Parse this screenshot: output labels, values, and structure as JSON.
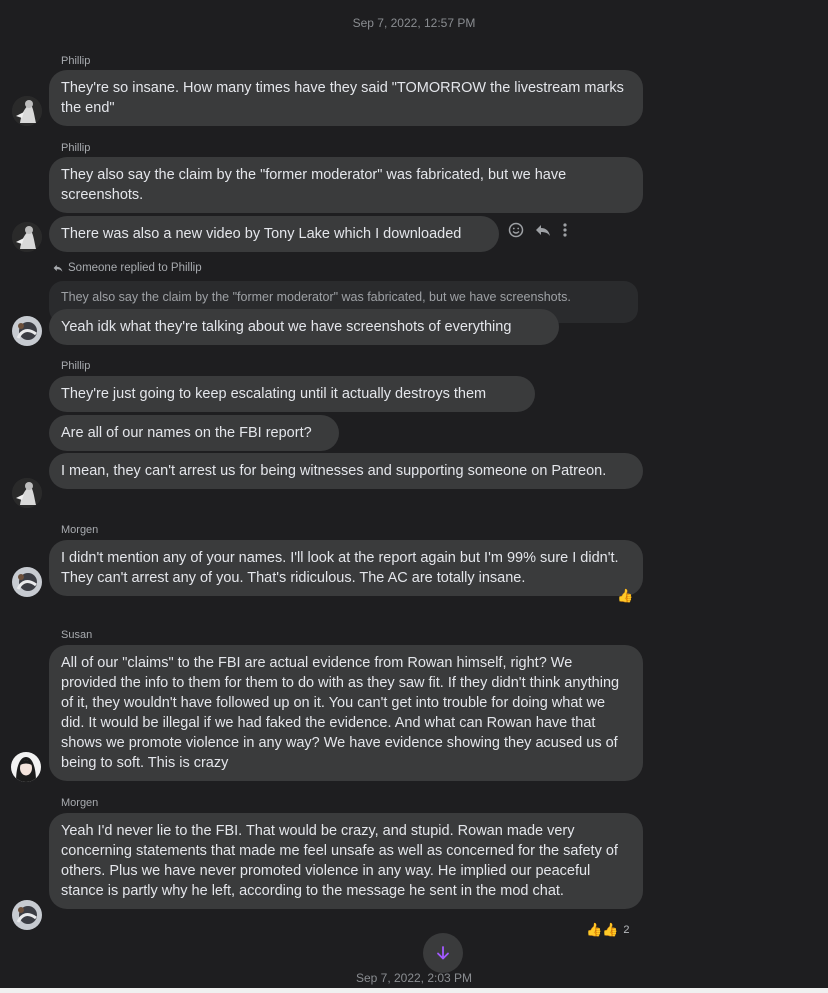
{
  "timestamps": {
    "top": "Sep 7, 2022, 12:57 PM",
    "bottom": "Sep 7, 2022, 2:03 PM"
  },
  "messages": [
    {
      "sender": "Phillip",
      "text": "They're so insane. How many times have they said \"TOMORROW the livestream marks the end\""
    },
    {
      "sender": "Phillip",
      "text1": "They also say the claim by the \"former moderator\" was fabricated, but we have screenshots.",
      "text2": "There was also a new video by Tony Lake which I downloaded"
    },
    {
      "reply_label": "Someone replied to Phillip",
      "quote": "They also say the claim by the \"former moderator\" was fabricated, but we have screenshots.",
      "text": "Yeah idk what they're talking about we have screenshots of everything"
    },
    {
      "sender": "Phillip",
      "text1": "They're just going to keep escalating until it actually destroys them",
      "text2": "Are all of our names on the FBI report?",
      "text3": "I mean, they can't arrest us for being witnesses and supporting someone on Patreon."
    },
    {
      "sender": "Morgen",
      "text": "I didn't mention any of your names. I'll look at the report again but I'm 99% sure I didn't. They can't arrest any of you. That's ridiculous. The AC are totally insane.",
      "reaction": "👍"
    },
    {
      "sender": "Susan",
      "text": "All of our \"claims\" to the FBI are actual evidence from Rowan himself, right? We provided the info to them for them to do with as they saw fit. If they didn't think anything of it, they wouldn't have followed up on it. You can't get into trouble for doing what we did. It would be illegal if we had faked the evidence. And what can Rowan have that shows we promote violence in any way? We have evidence showing they acused us of being to soft. This is crazy"
    },
    {
      "sender": "Morgen",
      "text": "Yeah I'd never lie to the FBI. That would be crazy, and stupid. Rowan made very concerning statements that made me feel unsafe as well as concerned for the safety of others. Plus we have never promoted violence in any way. He implied our peaceful stance is partly why he left, according to the message he sent in the mod chat.",
      "reactions": "👍👍",
      "reaction_count": "2"
    }
  ],
  "icons": {
    "emoji": "smiley-icon",
    "reply": "reply-arrow-icon",
    "more": "more-vertical-icon",
    "scroll": "arrow-down-icon"
  },
  "colors": {
    "background": "#1e1e20",
    "bubble": "#3a3b3c",
    "accent": "#a259ff"
  }
}
